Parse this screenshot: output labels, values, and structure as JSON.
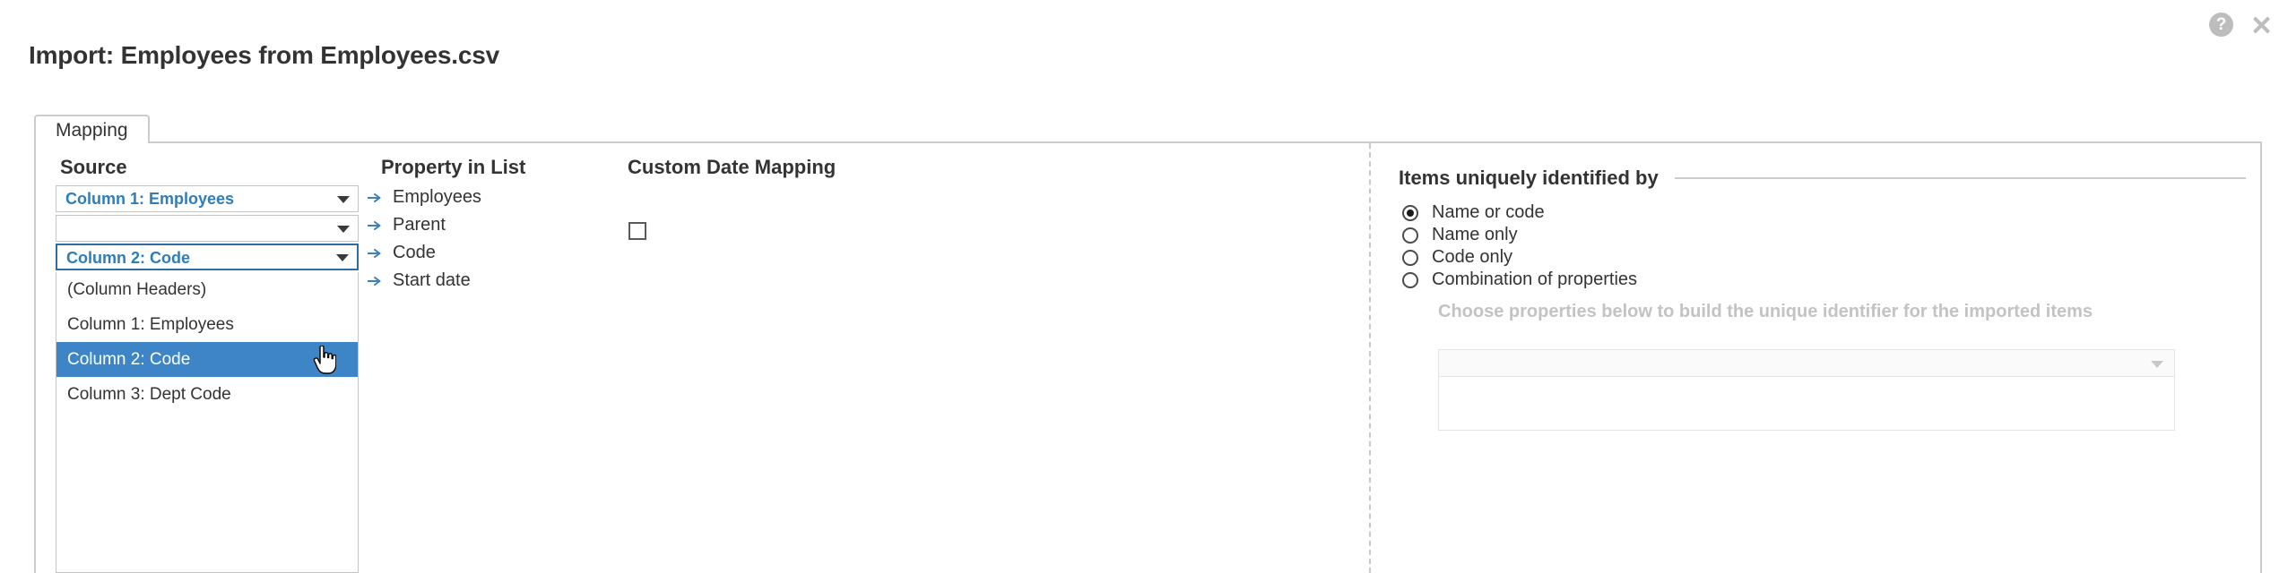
{
  "window": {
    "help_icon": "help-circle-icon",
    "help_glyph": "?",
    "close_icon": "close-icon"
  },
  "dialog": {
    "title": "Import: Employees from Employees.csv"
  },
  "tabs": [
    {
      "label": "Mapping",
      "active": true
    }
  ],
  "mapping": {
    "headers": {
      "source": "Source",
      "property": "Property in List",
      "custom_date": "Custom Date Mapping"
    },
    "source_selects": [
      {
        "value": "Column 1: Employees",
        "focused": false
      },
      {
        "value": "",
        "focused": false
      },
      {
        "value": "Column 2: Code",
        "focused": true
      }
    ],
    "dropdown_open": {
      "options": [
        "(Column Headers)",
        "Column 1: Employees",
        "Column 2: Code",
        "Column 3: Dept Code"
      ],
      "selected_index": 2,
      "cursor": "pointing-hand-cursor"
    },
    "properties": [
      "Employees",
      "Parent",
      "Code",
      "Start date"
    ],
    "custom_date_checkbox": {
      "checked": false,
      "row_index": 3
    }
  },
  "options": {
    "legend": "Items uniquely identified by",
    "radios": [
      {
        "label": "Name or code",
        "checked": true
      },
      {
        "label": "Name only",
        "checked": false
      },
      {
        "label": "Code only",
        "checked": false
      },
      {
        "label": "Combination of properties",
        "checked": false
      }
    ],
    "hint": "Choose properties below to build the unique identifier for the imported items",
    "property_select": {
      "value": "",
      "disabled": true
    }
  },
  "colors": {
    "accent_blue": "#2e7dba",
    "selection_blue": "#3d85c6",
    "focus_border": "#2e6da4",
    "border_gray": "#cccccc",
    "disabled_gray": "#c3c3c3",
    "text_dark": "#333333"
  }
}
